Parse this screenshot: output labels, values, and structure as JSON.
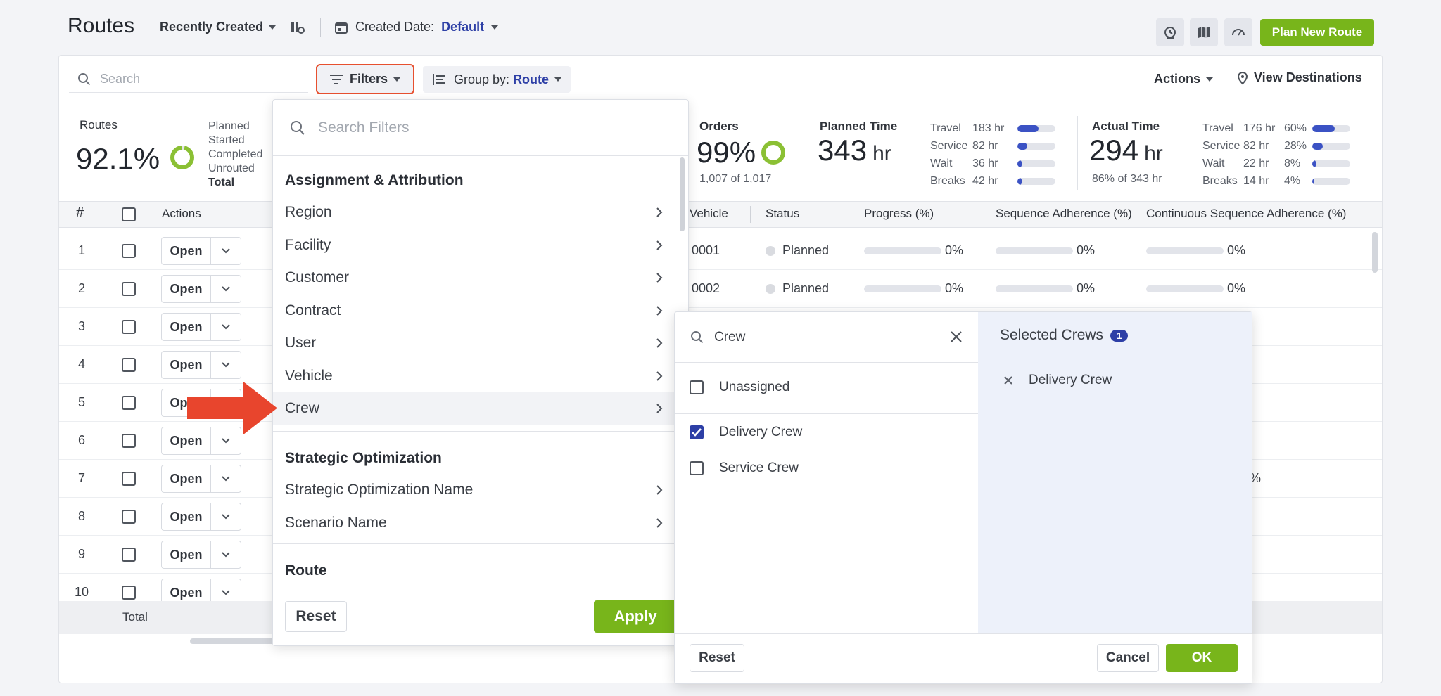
{
  "header": {
    "title": "Routes",
    "sort_label": "Recently Created",
    "date_label": "Created Date:",
    "date_value": "Default",
    "plan_button": "Plan New Route"
  },
  "toolbar": {
    "search_placeholder": "Search",
    "filters_label": "Filters",
    "group_by_label": "Group by:",
    "group_by_value": "Route",
    "actions_label": "Actions",
    "view_destinations_label": "View Destinations"
  },
  "summary": {
    "routes": {
      "label": "Routes",
      "percent": "92.1%",
      "statuses": [
        "Planned",
        "Started",
        "Completed",
        "Unrouted"
      ],
      "total_label": "Total"
    },
    "orders": {
      "label": "Orders",
      "percent": "99%",
      "sub": "1,007 of 1,017"
    },
    "planned_time": {
      "label": "Planned Time",
      "value": "343",
      "unit": "hr",
      "breakdown": [
        {
          "name": "Travel",
          "value": "183 hr",
          "fill": 0.55
        },
        {
          "name": "Service",
          "value": "82 hr",
          "fill": 0.25
        },
        {
          "name": "Wait",
          "value": "36 hr",
          "fill": 0.12
        },
        {
          "name": "Breaks",
          "value": "42 hr",
          "fill": 0.12
        }
      ]
    },
    "actual_time": {
      "label": "Actual Time",
      "value": "294",
      "unit": "hr",
      "sub": "86% of 343 hr",
      "breakdown": [
        {
          "name": "Travel",
          "value": "176 hr",
          "pct": "60%",
          "fill": 0.6
        },
        {
          "name": "Service",
          "value": "82 hr",
          "pct": "28%",
          "fill": 0.28
        },
        {
          "name": "Wait",
          "value": "22 hr",
          "pct": "8%",
          "fill": 0.1
        },
        {
          "name": "Breaks",
          "value": "14 hr",
          "pct": "4%",
          "fill": 0.06
        }
      ]
    }
  },
  "table": {
    "headers": {
      "num": "#",
      "actions": "Actions",
      "vehicle": "Vehicle",
      "status": "Status",
      "progress": "Progress (%)",
      "sequence": "Sequence Adherence (%)",
      "continuous": "Continuous Sequence Adherence (%)"
    },
    "open_label": "Open",
    "rows": [
      {
        "num": "1",
        "vehicle": "0001",
        "status": "Planned",
        "progress": "0%",
        "sequence": "0%",
        "continuous": "0%"
      },
      {
        "num": "2",
        "vehicle": "0002",
        "status": "Planned",
        "progress": "0%",
        "sequence": "0%",
        "continuous": "0%"
      },
      {
        "num": "3"
      },
      {
        "num": "4"
      },
      {
        "num": "5"
      },
      {
        "num": "6"
      },
      {
        "num": "7",
        "continuous_partial": "%"
      },
      {
        "num": "8"
      },
      {
        "num": "9"
      },
      {
        "num": "10"
      }
    ],
    "total_label": "Total"
  },
  "filter_panel": {
    "search_placeholder": "Search Filters",
    "sections": [
      {
        "title": "Assignment & Attribution",
        "items": [
          "Region",
          "Facility",
          "Customer",
          "Contract",
          "User",
          "Vehicle",
          "Crew"
        ]
      },
      {
        "title": "Strategic Optimization",
        "items": [
          "Strategic Optimization Name",
          "Scenario Name"
        ]
      },
      {
        "title": "Route",
        "items": []
      }
    ],
    "active_item": "Crew",
    "reset_label": "Reset",
    "apply_label": "Apply"
  },
  "crew_panel": {
    "search_value": "Crew",
    "options": [
      {
        "label": "Unassigned",
        "checked": false
      },
      {
        "label": "Delivery Crew",
        "checked": true
      },
      {
        "label": "Service Crew",
        "checked": false
      }
    ],
    "selected_title": "Selected Crews",
    "selected_count": "1",
    "selected_items": [
      "Delivery Crew"
    ],
    "reset_label": "Reset",
    "cancel_label": "Cancel",
    "ok_label": "OK"
  },
  "colors": {
    "accent_blue": "#2d3fa6",
    "brand_green": "#78b51b",
    "highlight_red": "#e7502f",
    "pointer_arrow": "#e8452d"
  }
}
